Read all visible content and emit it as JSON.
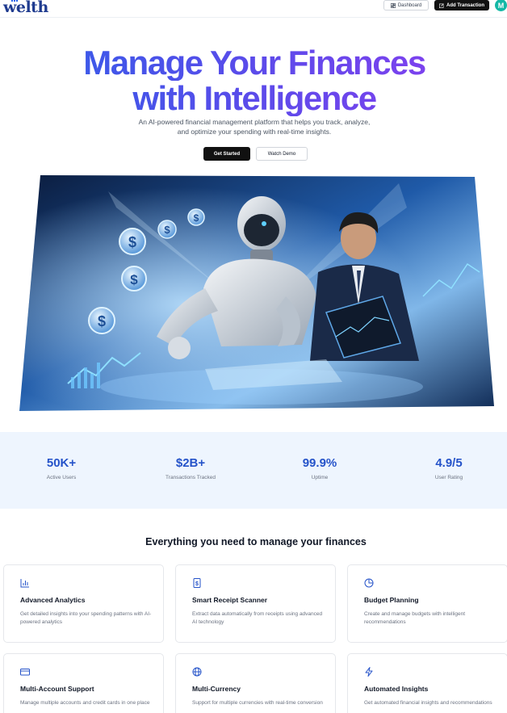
{
  "header": {
    "logo_text": "welth",
    "dashboard_label": "Dashboard",
    "add_transaction_label": "Add Transaction",
    "avatar_initial": "M"
  },
  "hero": {
    "title_line1": "Manage Your Finances",
    "title_line2": "with Intelligence",
    "subtitle": "An AI-powered financial management platform that helps you track, analyze, and optimize your spending with real-time insights.",
    "get_started_label": "Get Started",
    "watch_demo_label": "Watch Demo"
  },
  "stats": [
    {
      "value": "50K+",
      "label": "Active Users"
    },
    {
      "value": "$2B+",
      "label": "Transactions Tracked"
    },
    {
      "value": "99.9%",
      "label": "Uptime"
    },
    {
      "value": "4.9/5",
      "label": "User Rating"
    }
  ],
  "features": {
    "heading": "Everything you need to manage your finances",
    "items": [
      {
        "icon": "bar-chart-icon",
        "title": "Advanced Analytics",
        "description": "Get detailed insights into your spending patterns with AI-powered analytics"
      },
      {
        "icon": "receipt-icon",
        "title": "Smart Receipt Scanner",
        "description": "Extract data automatically from receipts using advanced AI technology"
      },
      {
        "icon": "pie-chart-icon",
        "title": "Budget Planning",
        "description": "Create and manage budgets with intelligent recommendations"
      },
      {
        "icon": "credit-card-icon",
        "title": "Multi-Account Support",
        "description": "Manage multiple accounts and credit cards in one place"
      },
      {
        "icon": "globe-icon",
        "title": "Multi-Currency",
        "description": "Support for multiple currencies with real-time conversion"
      },
      {
        "icon": "zap-icon",
        "title": "Automated Insights",
        "description": "Get automated financial insights and recommendations"
      }
    ]
  },
  "colors": {
    "accent": "#2553c9",
    "gradient_start": "#2f5ee8",
    "gradient_end": "#8b3df0",
    "stats_background": "#eef5fe"
  }
}
